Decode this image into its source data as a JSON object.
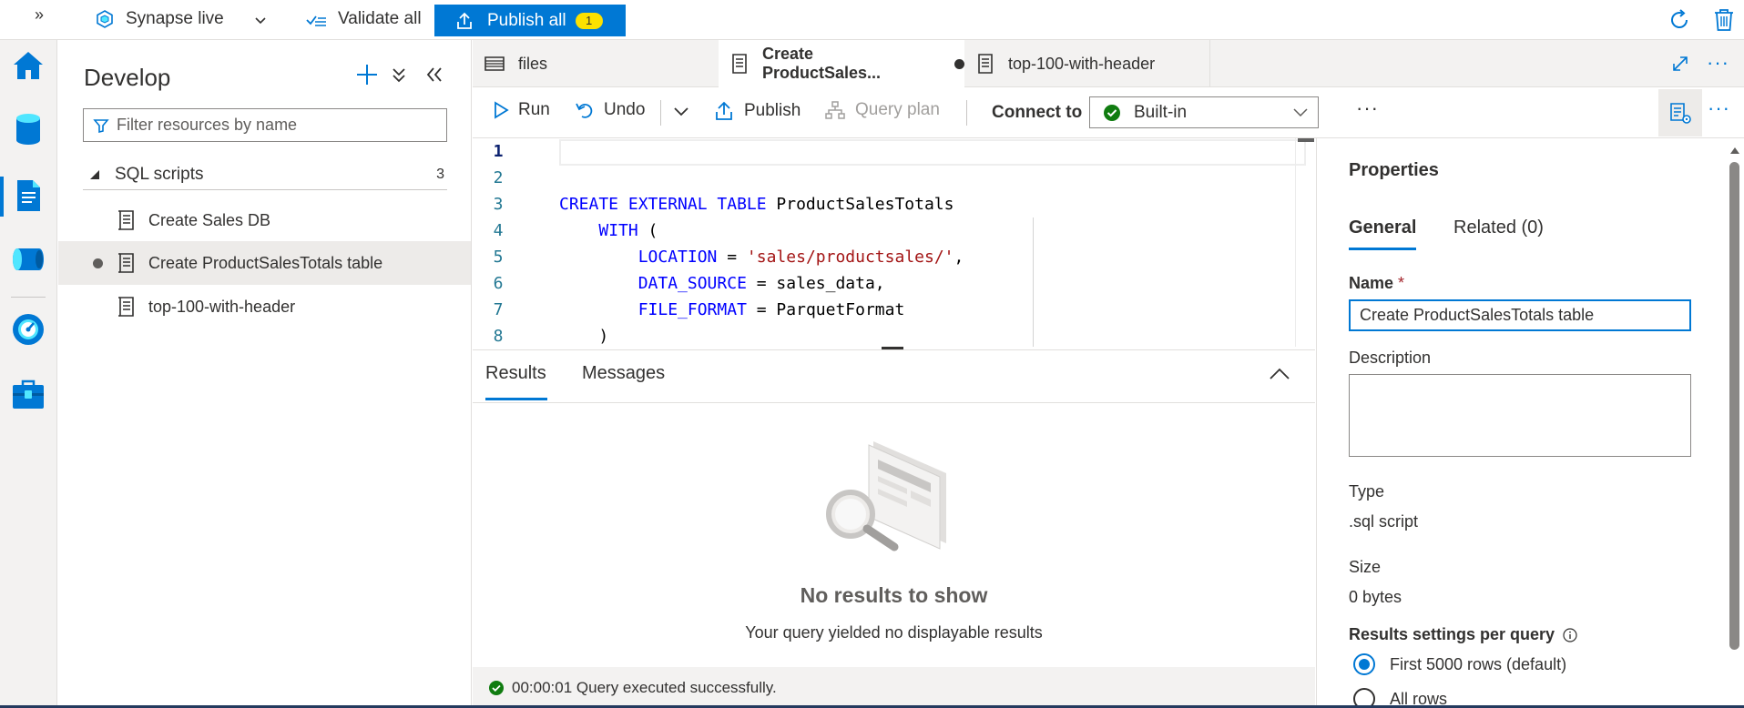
{
  "topbar": {
    "expand_glyph": "»",
    "live_label": "Synapse live",
    "validate_label": "Validate all",
    "publish_label": "Publish all",
    "publish_count": "1"
  },
  "rail": {
    "items": [
      "home-icon",
      "data-icon",
      "develop-icon",
      "integrate-icon",
      "monitor-icon",
      "manage-icon"
    ],
    "active": "develop-icon"
  },
  "develop": {
    "title": "Develop",
    "filter_placeholder": "Filter resources by name",
    "section": {
      "label": "SQL scripts",
      "count": "3"
    },
    "items": [
      {
        "label": "Create Sales DB",
        "selected": false,
        "unsaved": false
      },
      {
        "label": "Create ProductSalesTotals table",
        "selected": true,
        "unsaved": true
      },
      {
        "label": "top-100-with-header",
        "selected": false,
        "unsaved": false
      }
    ]
  },
  "tabs": [
    {
      "label": "files",
      "active": false
    },
    {
      "label": "Create ProductSales...",
      "active": true,
      "unsaved": true
    },
    {
      "label": "top-100-with-header",
      "active": false
    }
  ],
  "toolbar": {
    "run_label": "Run",
    "undo_label": "Undo",
    "publish_label": "Publish",
    "query_plan_label": "Query plan",
    "connect_label": "Connect to",
    "connect_value": "Built-in",
    "more_glyph": "···"
  },
  "editor": {
    "lines": [
      {
        "n": "1",
        "tokens": []
      },
      {
        "n": "2",
        "tokens": []
      },
      {
        "n": "3",
        "tokens": [
          {
            "t": "CREATE EXTERNAL TABLE",
            "c": "kw"
          },
          {
            "t": " ProductSalesTotals",
            "c": "plain"
          }
        ]
      },
      {
        "n": "4",
        "tokens": [
          {
            "t": "    ",
            "c": "plain"
          },
          {
            "t": "WITH",
            "c": "kw"
          },
          {
            "t": " (",
            "c": "plain"
          }
        ]
      },
      {
        "n": "5",
        "tokens": [
          {
            "t": "        ",
            "c": "plain"
          },
          {
            "t": "LOCATION",
            "c": "kw"
          },
          {
            "t": " = ",
            "c": "plain"
          },
          {
            "t": "'sales/productsales/'",
            "c": "str"
          },
          {
            "t": ",",
            "c": "plain"
          }
        ]
      },
      {
        "n": "6",
        "tokens": [
          {
            "t": "        ",
            "c": "plain"
          },
          {
            "t": "DATA_SOURCE",
            "c": "kw"
          },
          {
            "t": " = sales_data,",
            "c": "plain"
          }
        ]
      },
      {
        "n": "7",
        "tokens": [
          {
            "t": "        ",
            "c": "plain"
          },
          {
            "t": "FILE_FORMAT",
            "c": "kw"
          },
          {
            "t": " = ParquetFormat",
            "c": "plain"
          }
        ]
      },
      {
        "n": "8",
        "tokens": [
          {
            "t": "    )",
            "c": "plain"
          }
        ]
      }
    ]
  },
  "results": {
    "tabs": [
      "Results",
      "Messages"
    ],
    "empty_title": "No results to show",
    "empty_subtitle": "Your query yielded no displayable results",
    "status": "00:00:01 Query executed successfully."
  },
  "properties": {
    "title": "Properties",
    "tabs": [
      "General",
      "Related (0)"
    ],
    "name_label": "Name",
    "required_mark": "*",
    "name_value": "Create ProductSalesTotals table",
    "description_label": "Description",
    "description_value": "",
    "type_label": "Type",
    "type_value": ".sql script",
    "size_label": "Size",
    "size_value": "0 bytes",
    "results_label": "Results settings per query",
    "radio_options": [
      {
        "label": "First 5000 rows (default)",
        "checked": true
      },
      {
        "label": "All rows",
        "checked": false
      }
    ]
  },
  "colors": {
    "accent": "#0078d4",
    "badge": "#fce100",
    "success": "#107c10",
    "keyword": "#0000ff",
    "string": "#a31515"
  }
}
